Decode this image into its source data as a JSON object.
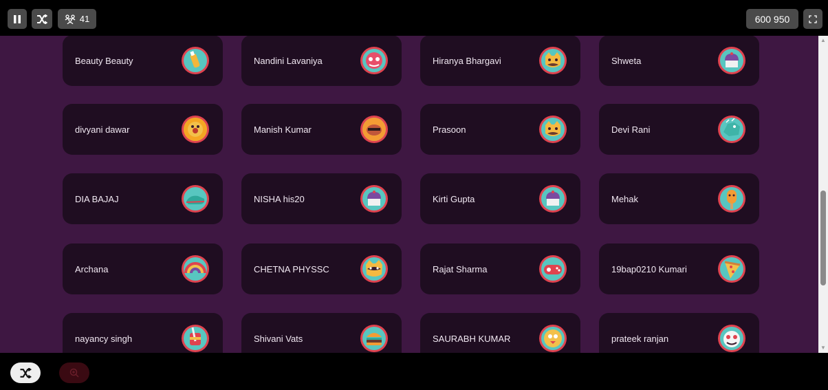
{
  "toolbar": {
    "players_count": "41",
    "score": "600 950"
  },
  "players": [
    {
      "name": "Beauty Beauty",
      "avatar": "bottle-avatar-icon"
    },
    {
      "name": "Nandini Lavaniya",
      "avatar": "monster-avatar-icon"
    },
    {
      "name": "Hiranya Bhargavi",
      "avatar": "cat-avatar-icon"
    },
    {
      "name": "Shweta",
      "avatar": "cupcake-avatar-icon"
    },
    {
      "name": "divyani dawar",
      "avatar": "donut-avatar-icon"
    },
    {
      "name": "Manish Kumar",
      "avatar": "sloth-avatar-icon"
    },
    {
      "name": "Prasoon",
      "avatar": "cat-avatar-icon"
    },
    {
      "name": "Devi Rani",
      "avatar": "dino-avatar-icon"
    },
    {
      "name": "DIA BAJAJ",
      "avatar": "sneaker-avatar-icon"
    },
    {
      "name": "NISHA his20",
      "avatar": "cupcake-avatar-icon"
    },
    {
      "name": "Kirti Gupta",
      "avatar": "cupcake-avatar-icon"
    },
    {
      "name": "Mehak",
      "avatar": "popsicle-avatar-icon"
    },
    {
      "name": "Archana",
      "avatar": "rainbow-avatar-icon"
    },
    {
      "name": "CHETNA PHYSSC",
      "avatar": "raccoon-avatar-icon"
    },
    {
      "name": "Rajat Sharma",
      "avatar": "gamepad-avatar-icon"
    },
    {
      "name": "19bap0210 Kumari",
      "avatar": "pizza-avatar-icon"
    },
    {
      "name": "nayancy singh",
      "avatar": "knight-avatar-icon"
    },
    {
      "name": "Shivani Vats",
      "avatar": "burger-avatar-icon"
    },
    {
      "name": "SAURABH KUMAR",
      "avatar": "bird-avatar-icon"
    },
    {
      "name": "prateek ranjan",
      "avatar": "blob-avatar-icon"
    }
  ],
  "colors": {
    "background": "#3e1742",
    "card": "#1f0d21",
    "accent_ring": "#e0434f"
  }
}
